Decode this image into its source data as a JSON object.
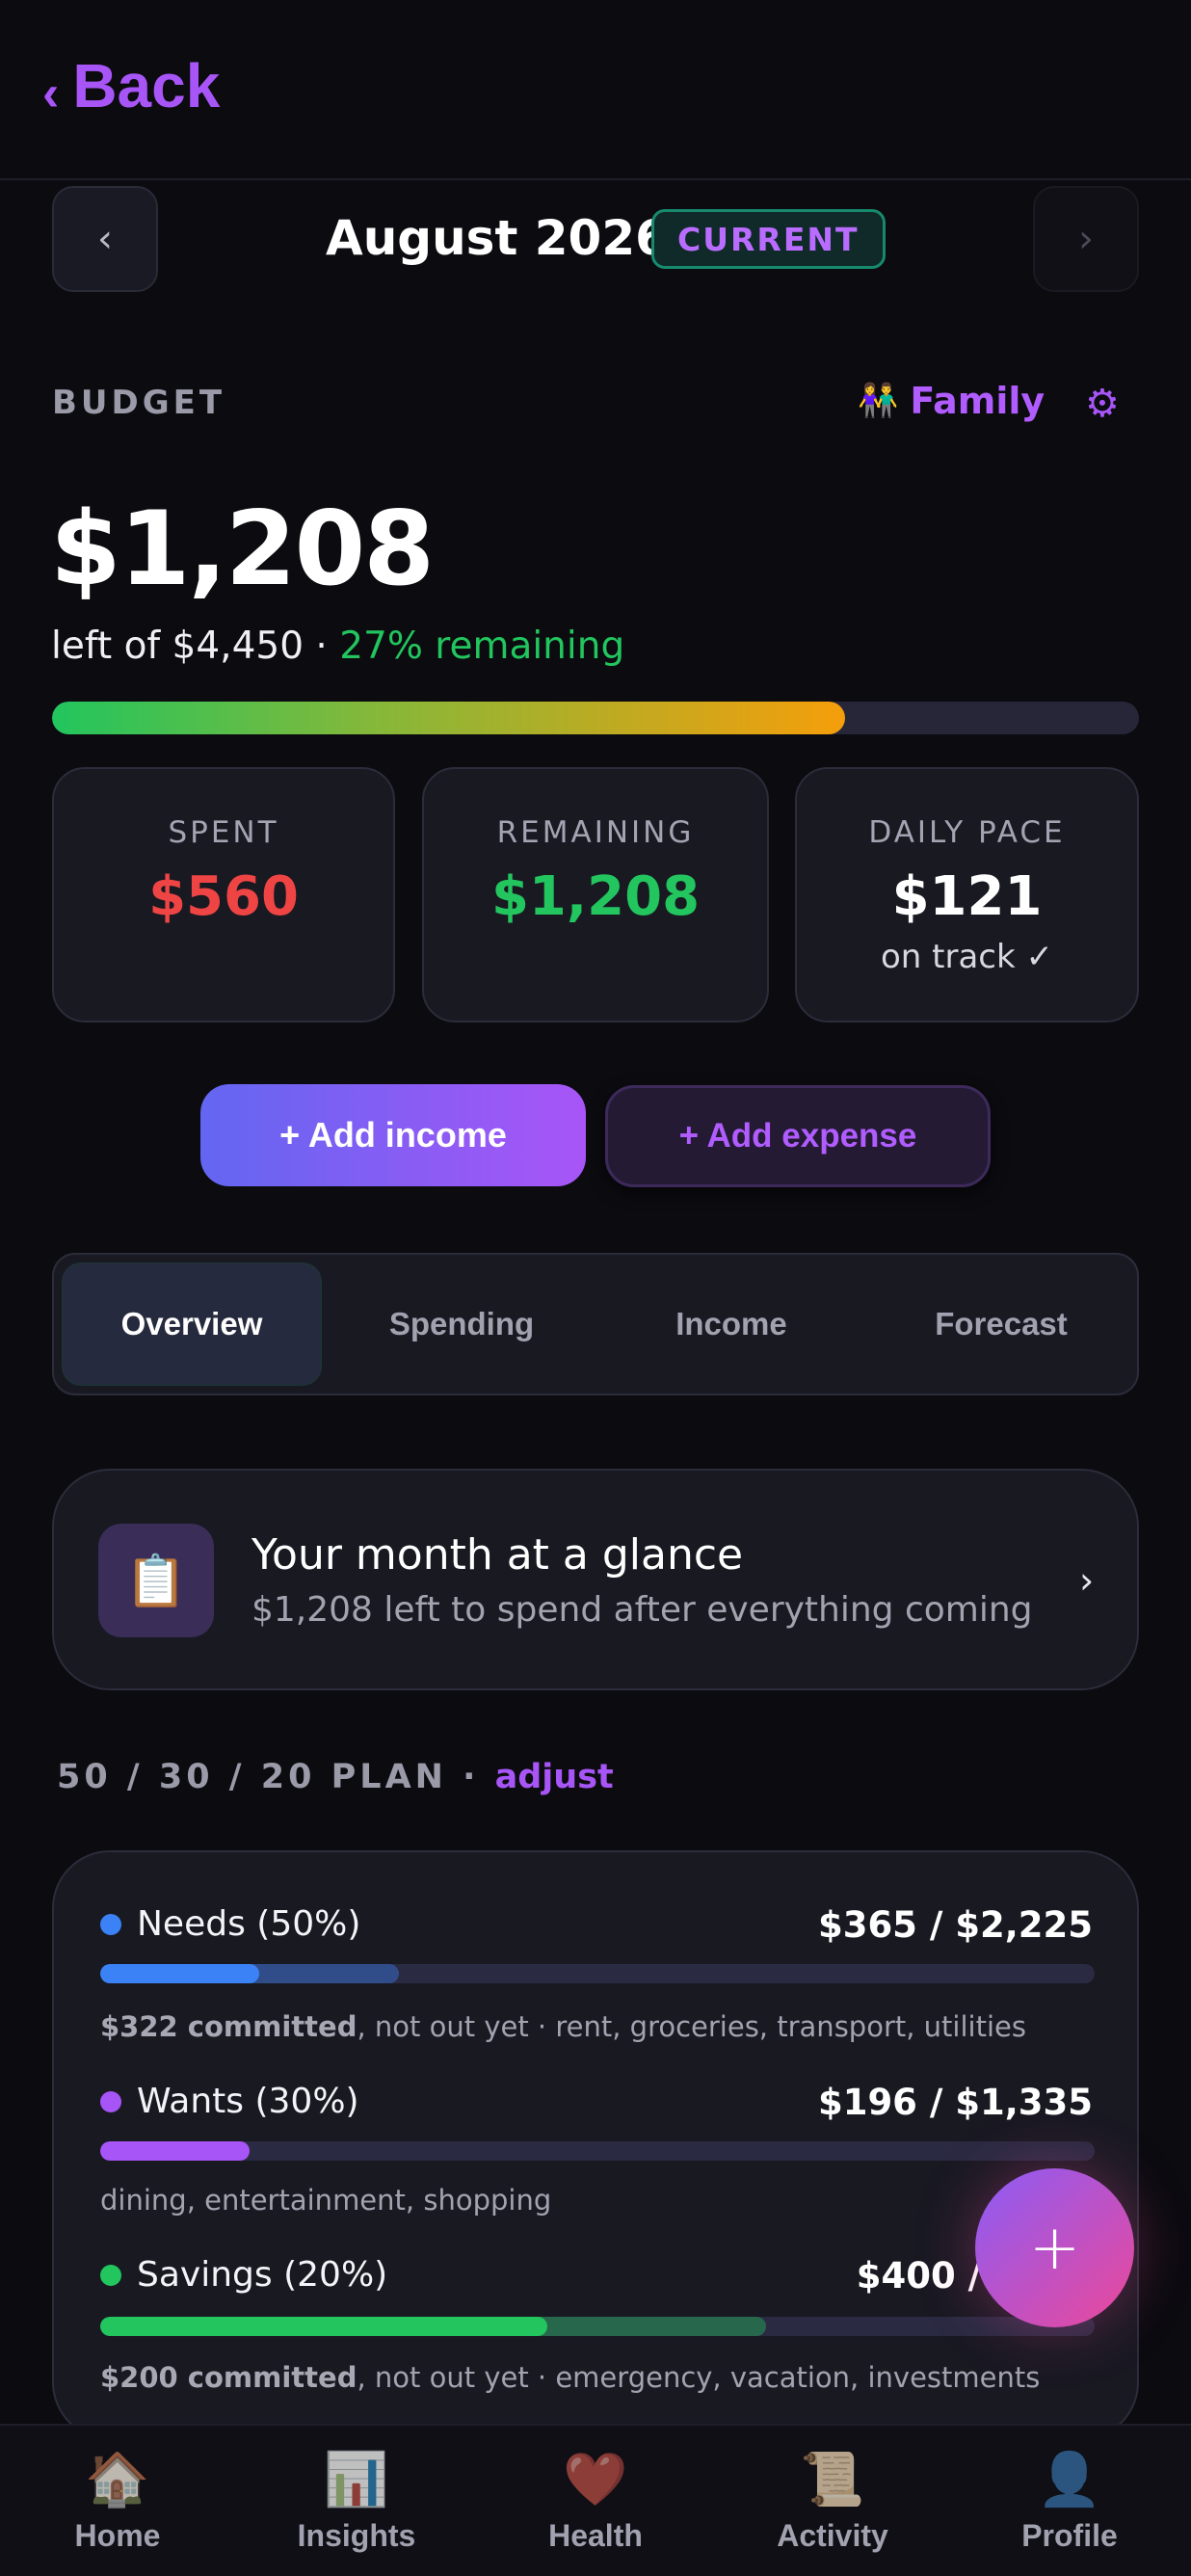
{
  "header": {
    "back_chevron": "‹",
    "back_label": "Back"
  },
  "month_nav": {
    "prev": "‹",
    "next": "›",
    "month": "August 2026",
    "badge": "CURRENT"
  },
  "budget": {
    "label": "BUDGET",
    "family_icon": "👫",
    "family_label": "Family",
    "gear_icon": "⚙",
    "amount_left": "$1,208",
    "left_of_text": "left of $4,450 · ",
    "remaining_pct_text": "27% remaining",
    "spent_fraction": 0.73
  },
  "stats": [
    {
      "label": "SPENT",
      "value": "$560",
      "color": "#ef4444"
    },
    {
      "label": "REMAINING",
      "value": "$1,208",
      "color": "#22c55e"
    },
    {
      "label": "DAILY PACE",
      "value": "$121",
      "color": "#ffffff",
      "sub": "on track ✓"
    }
  ],
  "actions": {
    "add_income": "+  Add income",
    "add_expense": "+  Add expense"
  },
  "tabs": [
    "Overview",
    "Spending",
    "Income",
    "Forecast"
  ],
  "active_tab": "Overview",
  "glance": {
    "icon": "📋",
    "title": "Your month at a glance",
    "description": "$1,208 left to spend after everything coming",
    "arrow": "›"
  },
  "plan": {
    "header": "50 / 30 / 20 PLAN · ",
    "adjust": "adjust",
    "rows": [
      {
        "name": "Needs (50%)",
        "amount": "$365 / $2,225",
        "color": "#3b82f6",
        "spent_fraction": 0.16,
        "committed_fraction": 0.3,
        "note_bold": "$322 committed",
        "note": ", not out yet · rent, groceries, transport, utilities"
      },
      {
        "name": "Wants (30%)",
        "amount": "$196 / $1,335",
        "color": "#a855f7",
        "spent_fraction": 0.15,
        "committed_fraction": 0,
        "note_bold": "",
        "note": "dining, entertainment, shopping"
      },
      {
        "name": "Savings (20%)",
        "amount": "$400 / $890",
        "color": "#22c55e",
        "spent_fraction": 0.45,
        "committed_fraction": 0.67,
        "note_bold": "$200 committed",
        "note": ", not out yet · emergency, vacation, investments"
      }
    ]
  },
  "fab": "+",
  "bottom_nav": [
    {
      "icon": "🏠",
      "label": "Home"
    },
    {
      "icon": "📊",
      "label": "Insights"
    },
    {
      "icon": "❤️",
      "label": "Health"
    },
    {
      "icon": "📜",
      "label": "Activity"
    },
    {
      "icon": "👤",
      "label": "Profile"
    }
  ]
}
